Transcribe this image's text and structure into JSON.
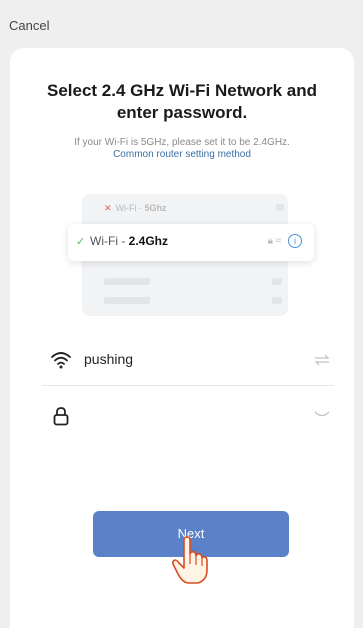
{
  "header": {
    "cancel_label": "Cancel"
  },
  "main": {
    "title_line1": "Select 2.4 GHz Wi-Fi Network and",
    "title_line2": "enter password.",
    "hint": "If your Wi-Fi is 5GHz, please set it to be 2.4GHz.",
    "link": "Common router setting method"
  },
  "illustration": {
    "row_5g_prefix": "Wi-Fi - ",
    "row_5g_bold": "5Ghz",
    "row_24_prefix": "Wi-Fi - ",
    "row_24_bold": "2.4Ghz",
    "info_glyph": "i"
  },
  "form": {
    "ssid_value": "pushing",
    "password_value": ""
  },
  "actions": {
    "next_label": "Next"
  },
  "colors": {
    "accent": "#5b82c9",
    "link": "#3a6ea5",
    "check": "#5cb85c",
    "error": "#e06060"
  },
  "icons": [
    "wifi-icon",
    "lock-icon",
    "swap-icon",
    "eye-closed-icon",
    "check-icon",
    "close-icon",
    "info-icon",
    "hand-pointer-icon"
  ]
}
